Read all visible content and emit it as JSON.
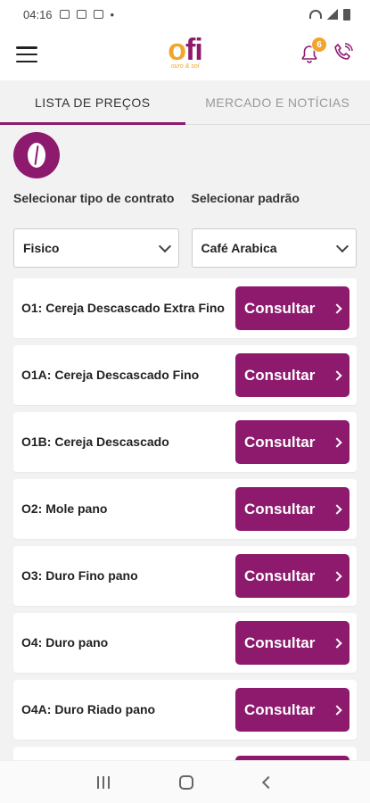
{
  "status": {
    "time": "04:16"
  },
  "appbar": {
    "logo_main": "fi",
    "logo_o": "o",
    "logo_tag": "ouro & sol",
    "notification_count": "6"
  },
  "tabs": [
    {
      "label": "LISTA DE PREÇOS",
      "active": true
    },
    {
      "label": "MERCADO E NOTÍCIAS",
      "active": false
    }
  ],
  "selectors": {
    "contract_label": "Selecionar tipo de contrato",
    "contract_value": "Fisico",
    "standard_label": "Selecionar padrão",
    "standard_value": "Café Arabica"
  },
  "items": [
    {
      "label": "O1: Cereja Descascado Extra Fino",
      "button": "Consultar"
    },
    {
      "label": "O1A: Cereja Descascado Fino",
      "button": "Consultar"
    },
    {
      "label": "O1B: Cereja Descascado",
      "button": "Consultar"
    },
    {
      "label": "O2: Mole pano",
      "button": "Consultar"
    },
    {
      "label": "O3: Duro Fino pano",
      "button": "Consultar"
    },
    {
      "label": "O4: Duro pano",
      "button": "Consultar"
    },
    {
      "label": "O4A: Duro Riado pano",
      "button": "Consultar"
    }
  ],
  "colors": {
    "brand": "#8e1a6e",
    "accent": "#f0a52c"
  }
}
